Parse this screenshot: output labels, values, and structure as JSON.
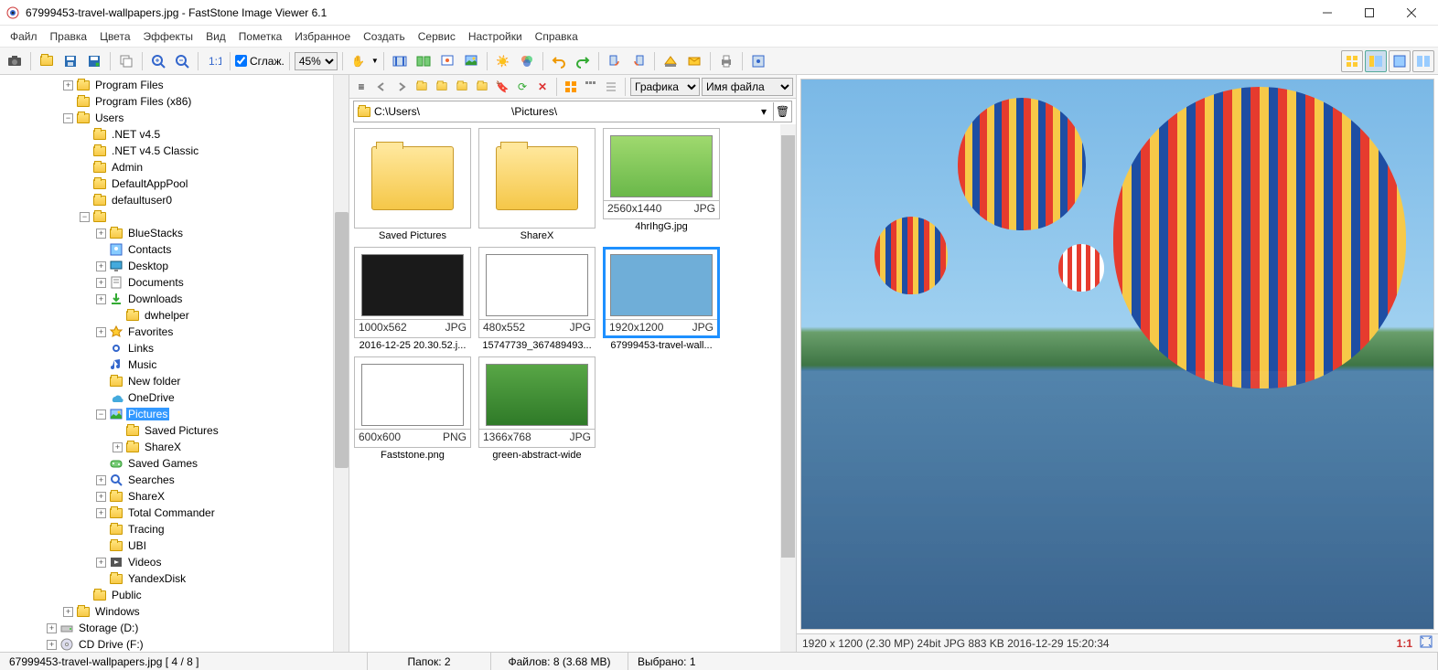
{
  "window": {
    "title": "67999453-travel-wallpapers.jpg  -  FastStone Image Viewer 6.1"
  },
  "menu": [
    "Файл",
    "Правка",
    "Цвета",
    "Эффекты",
    "Вид",
    "Пометка",
    "Избранное",
    "Создать",
    "Сервис",
    "Настройки",
    "Справка"
  ],
  "toolbar": {
    "smooth_label": "Сглаж.",
    "zoom": "45%"
  },
  "tree": [
    {
      "indent": 2,
      "tg": "+",
      "icon": "folder",
      "label": "Program Files"
    },
    {
      "indent": 2,
      "tg": "",
      "icon": "folder",
      "label": "Program Files (x86)"
    },
    {
      "indent": 2,
      "tg": "-",
      "icon": "folder",
      "label": "Users"
    },
    {
      "indent": 3,
      "tg": "",
      "icon": "folder",
      "label": ".NET v4.5"
    },
    {
      "indent": 3,
      "tg": "",
      "icon": "folder",
      "label": ".NET v4.5 Classic"
    },
    {
      "indent": 3,
      "tg": "",
      "icon": "folder",
      "label": "Admin"
    },
    {
      "indent": 3,
      "tg": "",
      "icon": "folder",
      "label": "DefaultAppPool"
    },
    {
      "indent": 3,
      "tg": "",
      "icon": "folder",
      "label": "defaultuser0"
    },
    {
      "indent": 3,
      "tg": "-",
      "icon": "folder",
      "label": ""
    },
    {
      "indent": 4,
      "tg": "+",
      "icon": "folder",
      "label": "BlueStacks"
    },
    {
      "indent": 4,
      "tg": "",
      "icon": "contacts",
      "label": "Contacts"
    },
    {
      "indent": 4,
      "tg": "+",
      "icon": "desktop",
      "label": "Desktop"
    },
    {
      "indent": 4,
      "tg": "+",
      "icon": "documents",
      "label": "Documents"
    },
    {
      "indent": 4,
      "tg": "+",
      "icon": "downloads",
      "label": "Downloads"
    },
    {
      "indent": 5,
      "tg": "",
      "icon": "folder",
      "label": "dwhelper"
    },
    {
      "indent": 4,
      "tg": "+",
      "icon": "favorites",
      "label": "Favorites"
    },
    {
      "indent": 4,
      "tg": "",
      "icon": "links",
      "label": "Links"
    },
    {
      "indent": 4,
      "tg": "",
      "icon": "music",
      "label": "Music"
    },
    {
      "indent": 4,
      "tg": "",
      "icon": "folder",
      "label": "New folder"
    },
    {
      "indent": 4,
      "tg": "",
      "icon": "onedrive",
      "label": "OneDrive"
    },
    {
      "indent": 4,
      "tg": "-",
      "icon": "pictures",
      "label": "Pictures",
      "selected": true
    },
    {
      "indent": 5,
      "tg": "",
      "icon": "folder",
      "label": "Saved Pictures"
    },
    {
      "indent": 5,
      "tg": "+",
      "icon": "folder",
      "label": "ShareX"
    },
    {
      "indent": 4,
      "tg": "",
      "icon": "savedgames",
      "label": "Saved Games"
    },
    {
      "indent": 4,
      "tg": "+",
      "icon": "search",
      "label": "Searches"
    },
    {
      "indent": 4,
      "tg": "+",
      "icon": "folder",
      "label": "ShareX"
    },
    {
      "indent": 4,
      "tg": "+",
      "icon": "folder",
      "label": "Total Commander"
    },
    {
      "indent": 4,
      "tg": "",
      "icon": "folder",
      "label": "Tracing"
    },
    {
      "indent": 4,
      "tg": "",
      "icon": "folder",
      "label": "UBI"
    },
    {
      "indent": 4,
      "tg": "+",
      "icon": "videos",
      "label": "Videos"
    },
    {
      "indent": 4,
      "tg": "",
      "icon": "folder",
      "label": "YandexDisk"
    },
    {
      "indent": 3,
      "tg": "",
      "icon": "folder",
      "label": "Public"
    },
    {
      "indent": 2,
      "tg": "+",
      "icon": "folder",
      "label": "Windows"
    },
    {
      "indent": 1,
      "tg": "+",
      "icon": "drive",
      "label": "Storage (D:)"
    },
    {
      "indent": 1,
      "tg": "+",
      "icon": "cd",
      "label": "CD Drive (F:)"
    }
  ],
  "center": {
    "dropdown1": "Графика",
    "dropdown2": "Имя файла",
    "path_prefix": "C:\\Users\\",
    "path_suffix": "\\Pictures\\"
  },
  "thumbs": [
    {
      "type": "folder",
      "caption": "Saved Pictures"
    },
    {
      "type": "folder",
      "caption": "ShareX"
    },
    {
      "type": "img",
      "dims": "2560x1440",
      "fmt": "JPG",
      "caption": "4hrIhgG.jpg",
      "bg": "linear-gradient(#9fd96e,#6ab84a)"
    },
    {
      "type": "img",
      "dims": "1000x562",
      "fmt": "JPG",
      "caption": "2016-12-25 20.30.52.j...",
      "bg": "#1a1a1a"
    },
    {
      "type": "img",
      "dims": "480x552",
      "fmt": "JPG",
      "caption": "15747739_367489493...",
      "bg": "#fff"
    },
    {
      "type": "img",
      "dims": "1920x1200",
      "fmt": "JPG",
      "caption": "67999453-travel-wall...",
      "selected": true,
      "bg": "#6faed8"
    },
    {
      "type": "img",
      "dims": "600x600",
      "fmt": "PNG",
      "caption": "Faststone.png",
      "bg": "#fff"
    },
    {
      "type": "img",
      "dims": "1366x768",
      "fmt": "JPG",
      "caption": "green-abstract-wide",
      "bg": "linear-gradient(#58a646,#2f7a28)"
    }
  ],
  "preview": {
    "info": "1920 x 1200 (2.30 MP)  24bit  JPG  883 KB  2016-12-29 15:20:34",
    "ratio": "1:1",
    "fit_icon": "fit-icon"
  },
  "status": {
    "left": "67999453-travel-wallpapers.jpg [ 4 / 8 ]",
    "folders": "Папок: 2",
    "files": "Файлов: 8 (3.68 MB)",
    "selected": "Выбрано: 1"
  }
}
